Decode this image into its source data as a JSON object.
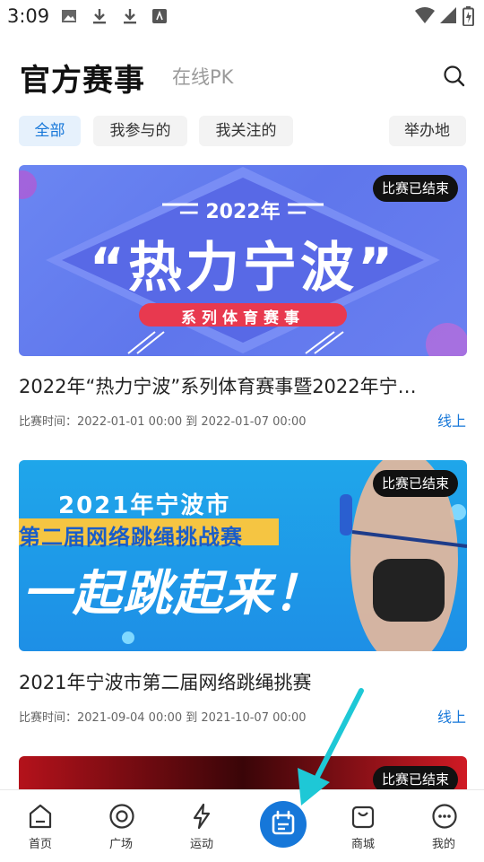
{
  "status_bar": {
    "time": "3:09"
  },
  "header": {
    "title": "官方赛事",
    "secondary_tab": "在线PK"
  },
  "filters": [
    "全部",
    "我参与的",
    "我关注的",
    "举办地"
  ],
  "events": [
    {
      "banner": {
        "year": "— 2022年 —",
        "title": "“热力宁波”",
        "ribbon": "系列体育赛事"
      },
      "status": "比赛已结束",
      "title": "2022年“热力宁波”系列体育赛事暨2022年宁…",
      "time": "比赛时间：2022-01-01 00:00 到 2022-01-07 00:00",
      "mode": "线上"
    },
    {
      "banner": {
        "line1": "2021年宁波市",
        "line2": "第二届网络跳绳挑战赛",
        "slogan": "一起跳起来！"
      },
      "status": "比赛已结束",
      "title": "2021年宁波市第二届网络跳绳挑赛",
      "time": "比赛时间：2021-09-04 00:00 到 2021-10-07 00:00",
      "mode": "线上"
    },
    {
      "status": "比赛已结束"
    }
  ],
  "bottom_nav": [
    {
      "label": "首页",
      "icon": "home-icon"
    },
    {
      "label": "广场",
      "icon": "plaza-icon"
    },
    {
      "label": "运动",
      "icon": "lightning-icon"
    },
    {
      "label": "",
      "icon": "calendar-icon"
    },
    {
      "label": "商城",
      "icon": "shop-bag-icon"
    },
    {
      "label": "我的",
      "icon": "profile-face-icon"
    }
  ],
  "colors": {
    "accent": "#1677d9",
    "arrow": "#1ec8d6"
  }
}
